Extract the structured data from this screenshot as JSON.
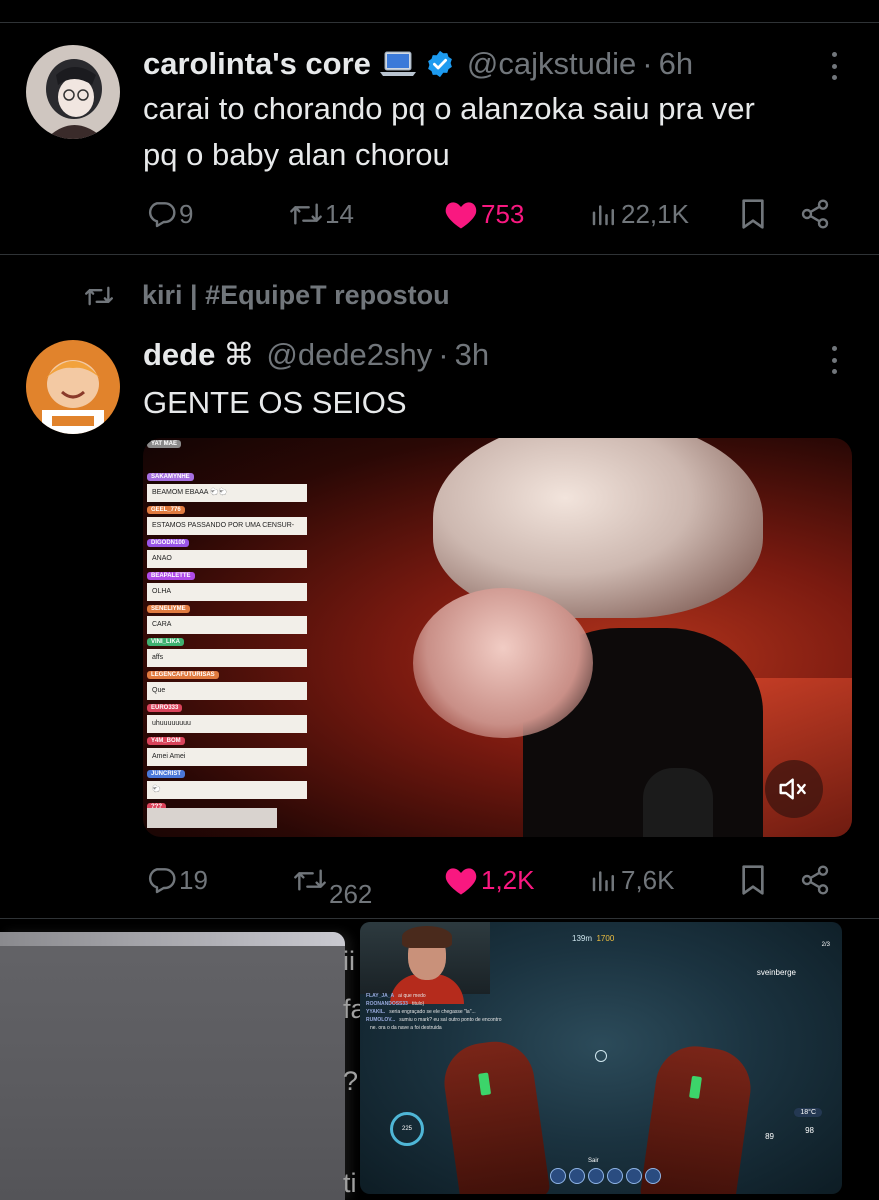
{
  "tweet1": {
    "display_name": "carolinta's core",
    "name_emoji": "laptop-emoji",
    "verified": true,
    "handle": "@cajkstudie",
    "time": "6h",
    "text": "carai to chorando pq o alanzoka saiu pra ver\npq o baby alan chorou",
    "replies": "9",
    "reposts": "14",
    "likes": "753",
    "views": "22,1K"
  },
  "repost_banner": {
    "text": "kiri | #EquipeT repostou"
  },
  "tweet2": {
    "display_name": "dede",
    "name_symbol": "⌘",
    "handle": "@dede2shy",
    "time": "3h",
    "text": "GENTE OS SEIOS",
    "replies": "19",
    "reposts": "262",
    "likes": "1,2K",
    "views": "7,6K",
    "video": {
      "muted": true,
      "chat": [
        {
          "user": "YAT MAE",
          "msg": "",
          "color": "#8a8a8a"
        },
        {
          "user": "SAKAMYNHE",
          "msg": "BEAMOM EBAAA 🐑🐑",
          "color": "#a56fe0"
        },
        {
          "user": "GEEL_776",
          "msg": "ESTAMOS PASSANDO POR UMA CENSUR-",
          "color": "#e07a3f"
        },
        {
          "user": "DIGODN100",
          "msg": "ANAO",
          "color": "#9a55e8"
        },
        {
          "user": "BEAPALETTE",
          "msg": "OLHA",
          "color": "#b04be8"
        },
        {
          "user": "SENELIYME",
          "msg": "CARA",
          "color": "#e07a3f"
        },
        {
          "user": "VINI_LIKA",
          "msg": "affs",
          "color": "#3fb070"
        },
        {
          "user": "LEGENCAFUTURISAS",
          "msg": "Que",
          "color": "#e07a3f"
        },
        {
          "user": "EURO333",
          "msg": "uhuuuuuuuu",
          "color": "#d9435a"
        },
        {
          "user": "Y4M_BOM",
          "msg": "Amei Amei",
          "color": "#d9435a"
        },
        {
          "user": "JUNCRIST",
          "msg": "🐑",
          "color": "#4a78d9"
        },
        {
          "user": "???",
          "msg": "",
          "color": "#d9435a"
        }
      ]
    }
  },
  "next_post": {
    "text_fragments": [
      "ii",
      "fa",
      "?",
      "ti"
    ],
    "game_overlay": {
      "depth": "139m",
      "heading": "1700",
      "player_name": "sveinberge",
      "distance_label": "2/3",
      "chat_lines": [
        {
          "user": "FLAY_JA_A",
          "msg": "ai que medo"
        },
        {
          "user": "ROONANDOSS33",
          "msg": "titulo)"
        },
        {
          "user": "YYAKIL.",
          "msg": "seria engraçado se ele chegasse \"la\"..."
        },
        {
          "user": "RUMOLOV...",
          "msg": "sumiu o mark? eu saí outro ponto de encontro"
        },
        {
          "user": "",
          "msg": "ne. ora o da nave a foi destruida"
        }
      ],
      "oxygen": "225",
      "temperature": "18°C",
      "health": "89",
      "power": "98",
      "exit_label": "Sair"
    }
  },
  "colors": {
    "background": "#000000",
    "text_primary": "#e7e9ea",
    "text_secondary": "#71767b",
    "like": "#f91880",
    "verified": "#1d9bf0",
    "divider": "#2f3336"
  }
}
